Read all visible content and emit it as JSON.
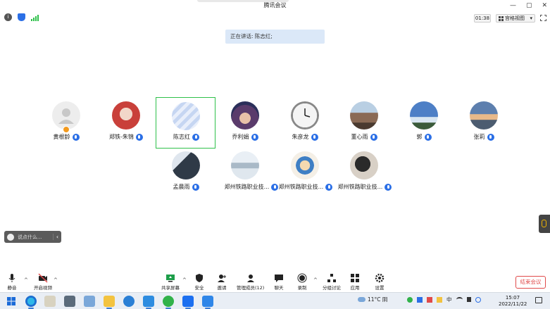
{
  "window": {
    "title": "腾讯会议"
  },
  "status": {
    "timer": "01:38",
    "view_label": "宫格视图",
    "view_caret": "▾"
  },
  "speaking": {
    "text": "正在讲话: 陈志红;"
  },
  "participants": [
    {
      "name": "黄根龄",
      "avatar": "default-avatar"
    },
    {
      "name": "郑铁-朱锦",
      "avatar": "red-photo-avatar"
    },
    {
      "name": "陈志红",
      "avatar": "blue-stripe-avatar",
      "active": true
    },
    {
      "name": "乔利娟",
      "avatar": "cartoon-girl-avatar"
    },
    {
      "name": "朱彦龙",
      "avatar": "clock-avatar"
    },
    {
      "name": "董心雨",
      "avatar": "street-photo-avatar"
    },
    {
      "name": "郭",
      "avatar": "sky-photo-avatar"
    },
    {
      "name": "张莉",
      "avatar": "sunset-photo-avatar"
    },
    {
      "name": "孟晨雨",
      "avatar": "window-photo-avatar"
    },
    {
      "name": "郑州铁路职业技...",
      "avatar": "lake-photo-avatar"
    },
    {
      "name": "郑州铁路职业技...",
      "avatar": "cartoon-boy-avatar"
    },
    {
      "name": "郑州铁路职业技...",
      "avatar": "shadow-photo-avatar"
    }
  ],
  "chat": {
    "placeholder": "说点什么...",
    "collapse": "‹"
  },
  "toolbar": {
    "mute": "静音",
    "video": "开启视频",
    "share": "共享屏幕",
    "security": "安全",
    "invite": "邀请",
    "members": "管理成员(12)",
    "chat": "聊天",
    "record": "录制",
    "breakout": "分组讨论",
    "apps": "应用",
    "settings": "设置",
    "end": "结束会议",
    "caret": "^"
  },
  "taskbar": {
    "weather": "11°C 阴",
    "ime": "中",
    "time": "15:07",
    "date": "2022/11/22"
  },
  "colors": {
    "accent": "#2b6fe6",
    "active_border": "#2ec04a",
    "end_red": "#e04a4a"
  }
}
